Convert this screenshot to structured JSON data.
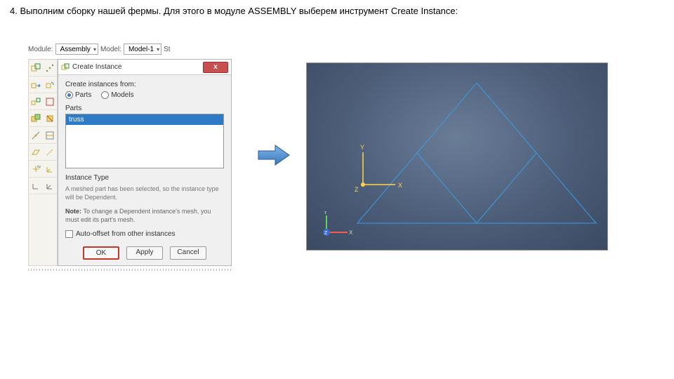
{
  "heading": "4. Выполним сборку нашей фермы. Для этого в модуле ASSEMBLY выберем инструмент Create Instance:",
  "toolbar": {
    "module_label": "Module:",
    "module_value": "Assembly",
    "model_label": "Model:",
    "model_value": "Model-1",
    "step_label": "St"
  },
  "dialog": {
    "title": "Create Instance",
    "close_icon": "x",
    "from_label": "Create instances from:",
    "radio_parts": "Parts",
    "radio_models": "Models",
    "parts_label": "Parts",
    "part_item": "truss",
    "type_label": "Instance Type",
    "type_info": "A meshed part has been selected, so the instance type will be Dependent.",
    "note_prefix": "Note:",
    "note_text": "To change a Dependent instance's mesh, you must edit its part's mesh.",
    "auto_offset": "Auto-offset from other instances",
    "ok": "OK",
    "apply": "Apply",
    "cancel": "Cancel"
  },
  "axes": {
    "x": "X",
    "y": "Y",
    "z": "Z"
  },
  "triad": {
    "x": "X",
    "y": "Y",
    "z": "Z"
  }
}
